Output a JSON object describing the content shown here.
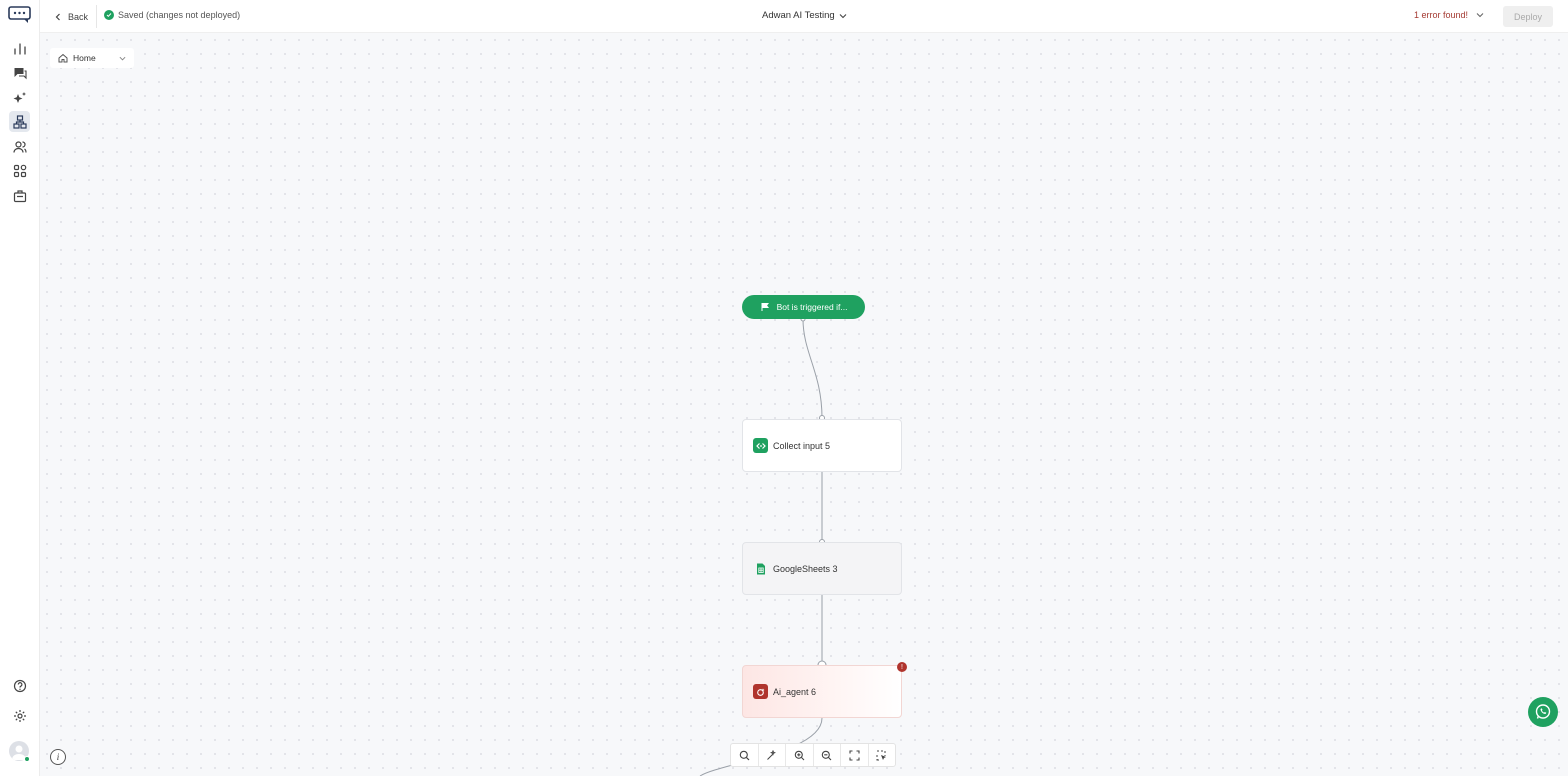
{
  "header": {
    "back_label": "Back",
    "saved_status": "Saved (changes not deployed)",
    "bot_name": "Adwan AI Testing",
    "error_text": "1 error found!",
    "deploy_label": "Deploy"
  },
  "canvas": {
    "breadcrumb": "Home",
    "trigger_label": "Bot is triggered if...",
    "nodes": [
      {
        "label": "Collect input 5",
        "icon": "collect-input-icon"
      },
      {
        "label": "GoogleSheets 3",
        "icon": "google-sheets-icon"
      },
      {
        "label": "Ai_agent 6",
        "icon": "ai-agent-icon",
        "has_error": true
      }
    ],
    "error_badge": "!",
    "info_label": "i"
  },
  "colors": {
    "brand_green": "#1fa160",
    "error_red": "#b0342d",
    "sidebar_active": "#e4e8ee"
  },
  "sidebar": {
    "items": [
      {
        "icon": "analytics-icon"
      },
      {
        "icon": "conversations-icon"
      },
      {
        "icon": "ai-sparkle-icon"
      },
      {
        "icon": "flow-builder-icon",
        "active": true
      },
      {
        "icon": "contacts-icon"
      },
      {
        "icon": "integrations-icon"
      },
      {
        "icon": "campaigns-icon"
      }
    ],
    "bottom": [
      {
        "icon": "help-icon"
      },
      {
        "icon": "settings-icon"
      }
    ]
  }
}
